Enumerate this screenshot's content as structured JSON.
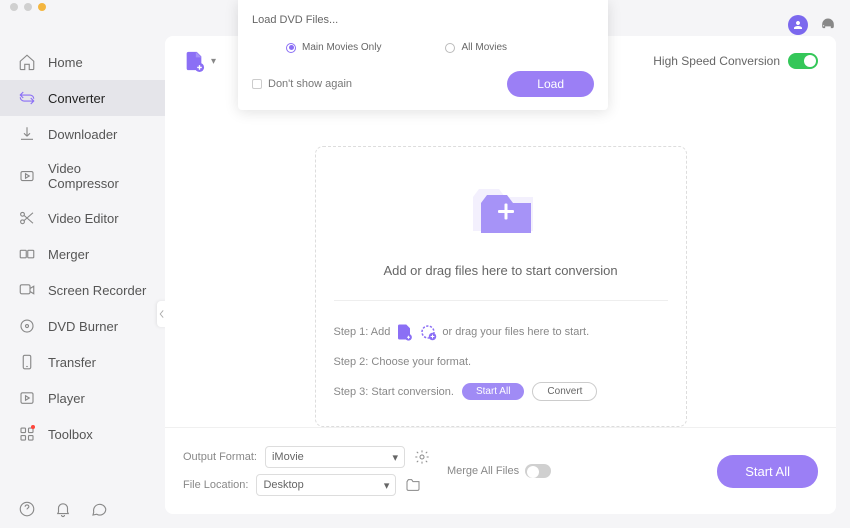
{
  "sidebar": {
    "items": [
      {
        "label": "Home"
      },
      {
        "label": "Converter"
      },
      {
        "label": "Downloader"
      },
      {
        "label": "Video Compressor"
      },
      {
        "label": "Video Editor"
      },
      {
        "label": "Merger"
      },
      {
        "label": "Screen Recorder"
      },
      {
        "label": "DVD Burner"
      },
      {
        "label": "Transfer"
      },
      {
        "label": "Player"
      },
      {
        "label": "Toolbox"
      }
    ]
  },
  "toolbar": {
    "hsc_label": "High Speed Conversion"
  },
  "dropzone": {
    "text": "Add or drag files here to start conversion",
    "step1": "Step 1: Add",
    "step1_tail": "or drag your files here to start.",
    "step2": "Step 2: Choose your format.",
    "step3": "Step 3: Start conversion.",
    "start_all": "Start  All",
    "convert": "Convert"
  },
  "footer": {
    "output_format_label": "Output Format:",
    "output_format_value": "iMovie",
    "file_location_label": "File Location:",
    "file_location_value": "Desktop",
    "merge_label": "Merge All Files",
    "start_all": "Start All"
  },
  "dialog": {
    "title": "Load DVD Files...",
    "main_movies": "Main Movies Only",
    "all_movies": "All Movies",
    "dont_show": "Don't show again",
    "load": "Load"
  }
}
